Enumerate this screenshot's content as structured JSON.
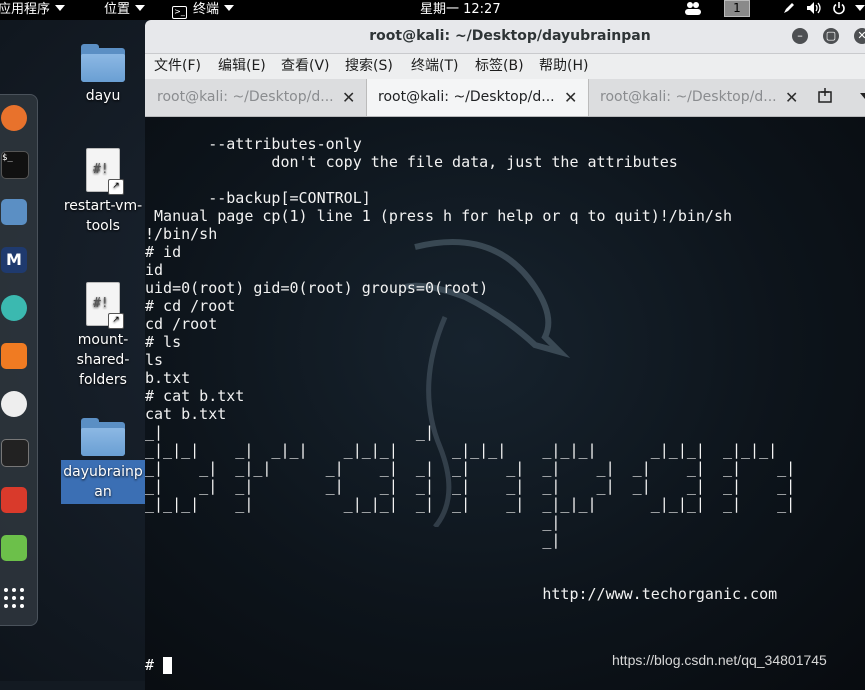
{
  "topbar": {
    "applications": "应用程序",
    "places": "位置",
    "terminal_menu": "终端",
    "clock": "星期一 12:27",
    "workspace": "1"
  },
  "desktop_icons": {
    "dayu": "dayu",
    "restart": "restart-vm-tools",
    "mount": "mount-shared-folders",
    "dayubrainpan": "dayubrainpan"
  },
  "window": {
    "title": "root@kali: ~/Desktop/dayubrainpan",
    "menu": [
      "文件(F)",
      "编辑(E)",
      "查看(V)",
      "搜索(S)",
      "终端(T)",
      "标签(B)",
      "帮助(H)"
    ],
    "tabs": [
      {
        "label": "root@kali: ~/Desktop/d...",
        "active": false
      },
      {
        "label": "root@kali: ~/Desktop/d...",
        "active": true
      },
      {
        "label": "root@kali: ~/Desktop/d...",
        "active": false
      }
    ]
  },
  "terminal": {
    "output": "       --attributes-only\n              don't copy the file data, just the attributes\n\n       --backup[=CONTROL]\n Manual page cp(1) line 1 (press h for help or q to quit)!/bin/sh\n!/bin/sh\n# id\nid\nuid=0(root) gid=0(root) groups=0(root)\n# cd /root\ncd /root\n# ls\nls\nb.txt\n# cat b.txt\ncat b.txt\n_|                            _|\n_|_|_|    _|  _|_|    _|_|_|      _|_|_|    _|_|_|      _|_|_|  _|_|_|\n_|    _|  _|_|      _|    _|  _|  _|    _|  _|    _|  _|    _|  _|    _|\n_|    _|  _|        _|    _|  _|  _|    _|  _|    _|  _|    _|  _|    _|\n_|_|_|    _|          _|_|_|  _|  _|    _|  _|_|_|      _|_|_|  _|    _|\n                                            _|\n                                            _|\n\n\n                                            http://www.techorganic.com",
    "prompt": "#"
  },
  "watermark": "https://blog.csdn.net/qq_34801745"
}
